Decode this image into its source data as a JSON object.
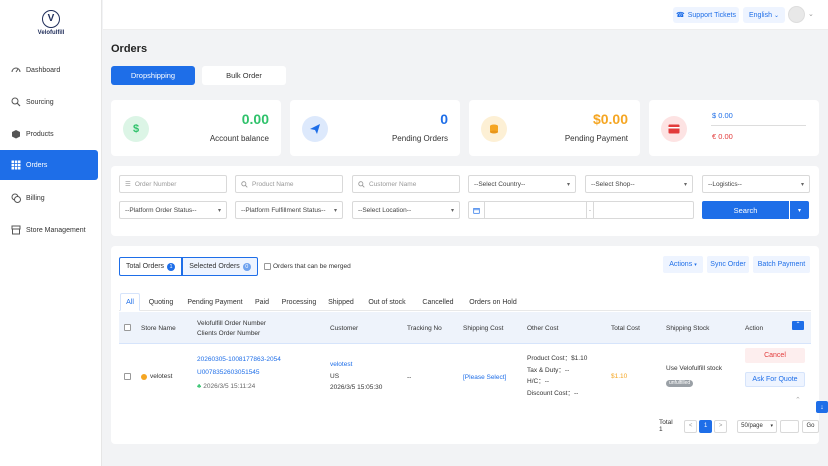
{
  "brand": {
    "name": "Velofulfill",
    "mark": "V"
  },
  "sidebar": {
    "items": [
      {
        "label": "Dashboard",
        "icon": "dashboard-icon"
      },
      {
        "label": "Sourcing",
        "icon": "search-icon"
      },
      {
        "label": "Products",
        "icon": "box-icon"
      },
      {
        "label": "Orders",
        "icon": "grid-icon",
        "active": true
      },
      {
        "label": "Billing",
        "icon": "coins-icon"
      },
      {
        "label": "Store Management",
        "icon": "store-icon"
      }
    ]
  },
  "topbar": {
    "support": "Support Tickets",
    "language": "English"
  },
  "page": {
    "title": "Orders",
    "tabs": [
      "Dropshipping",
      "Bulk Order"
    ]
  },
  "stats": [
    {
      "icon": "$",
      "value": "0.00",
      "label": "Account balance",
      "color": "#2fc26b"
    },
    {
      "icon": "plane",
      "value": "0",
      "label": "Pending Orders",
      "color": "#1e6ee8"
    },
    {
      "icon": "coins",
      "value": "$0.00",
      "label": "Pending Payment",
      "color": "#f5a623"
    },
    {
      "icon": "card",
      "value_usd": "$ 0.00",
      "value_eur": "€ 0.00",
      "color": "#e23b3b"
    }
  ],
  "filters": {
    "order_number": "Order Number",
    "product_name": "Product Name",
    "customer_name": "Customer Name",
    "country": "--Select Country--",
    "shop": "--Select Shop--",
    "logistics": "--Logistics--",
    "platform_status": "--Platform Order Status--",
    "fulfillment_status": "--Platform Fulfillment Status--",
    "location": "--Select Location--",
    "date_sep": "-",
    "search": "Search"
  },
  "orders": {
    "total_label": "Total Orders",
    "total_count": "1",
    "selected_label": "Selected Orders",
    "selected_count": "0",
    "merge_label": "Orders that can be merged",
    "actions": [
      "Actions",
      "Sync Order",
      "Batch Payment"
    ],
    "status_tabs": [
      "All",
      "Quoting",
      "Pending Payment",
      "Paid",
      "Processing",
      "Shipped",
      "Out of stock",
      "Cancelled",
      "Orders on Hold"
    ],
    "headers": {
      "store": "Store Name",
      "order_no_1": "Velofulfill Order Number",
      "order_no_2": "Clients Order Number",
      "customer": "Customer",
      "tracking": "Tracking No",
      "shipping_cost": "Shipping Cost",
      "other_cost": "Other Cost",
      "total_cost": "Total Cost",
      "shipping_stock": "Shipping Stock",
      "action": "Action"
    },
    "row": {
      "store": "velotest",
      "velo_order": "20260305-1008177863-2054",
      "client_order": "U0078352603051545",
      "created": "2026/3/5 15:11:24",
      "customer_name": "velotest",
      "customer_country": "US",
      "customer_time": "2026/3/5 15:05:30",
      "tracking": "--",
      "shipping_cost": "[Please Select]",
      "product_cost": "Product Cost：$1.10",
      "tax": "Tax & Duty：--",
      "hc": "H/C：--",
      "discount": "Discount Cost：--",
      "total_cost": "$1.10",
      "stock_label": "Use Velofulfill stock",
      "stock_tag": "unfulfilled",
      "cancel": "Cancel",
      "quote": "Ask For Quote"
    },
    "pager": {
      "total": "Total 1",
      "prev": "<",
      "page": "1",
      "next": ">",
      "per_page": "50/page",
      "go": "Go"
    }
  }
}
